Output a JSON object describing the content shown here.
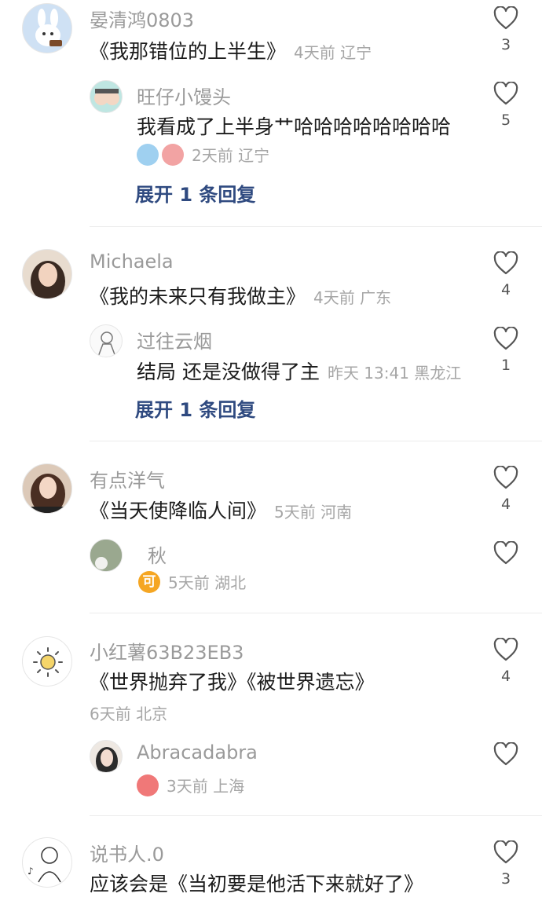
{
  "comments": [
    {
      "name": "晏清鸿0803",
      "text": "《我那错位的上半生》",
      "meta": "4天前 辽宁",
      "likes": "3",
      "reply": {
        "name": "旺仔小馒头",
        "text": "我看成了上半身艹哈哈哈哈哈哈哈哈",
        "meta": "2天前 辽宁",
        "likes": "5"
      },
      "expand": "展开 1 条回复"
    },
    {
      "name": "Michaela",
      "text": "《我的未来只有我做主》",
      "meta": "4天前 广东",
      "likes": "4",
      "reply": {
        "name": "过往云烟",
        "text": "结局 还是没做得了主",
        "meta": "昨天 13:41 黑龙江",
        "likes": "1"
      },
      "expand": "展开 1 条回复"
    },
    {
      "name": "有点洋气",
      "text": "《当天使降临人间》",
      "meta": "5天前 河南",
      "likes": "4",
      "reply": {
        "name": "秋",
        "sticker_text": "可",
        "meta": "5天前 湖北",
        "likes": ""
      }
    },
    {
      "name": "小红薯63B23EB3",
      "text": "《世界抛弃了我》《被世界遗忘》",
      "meta": "6天前 北京",
      "likes": "4",
      "reply": {
        "name": "Abracadabra",
        "meta": "3天前 上海",
        "likes": ""
      }
    },
    {
      "name": "说书人.0",
      "text": "应该会是《当初要是他活下来就好了》",
      "likes": "3"
    }
  ],
  "colors": {
    "link": "#2f4a80",
    "meta": "#a6a6a6",
    "heart": "#555555"
  }
}
